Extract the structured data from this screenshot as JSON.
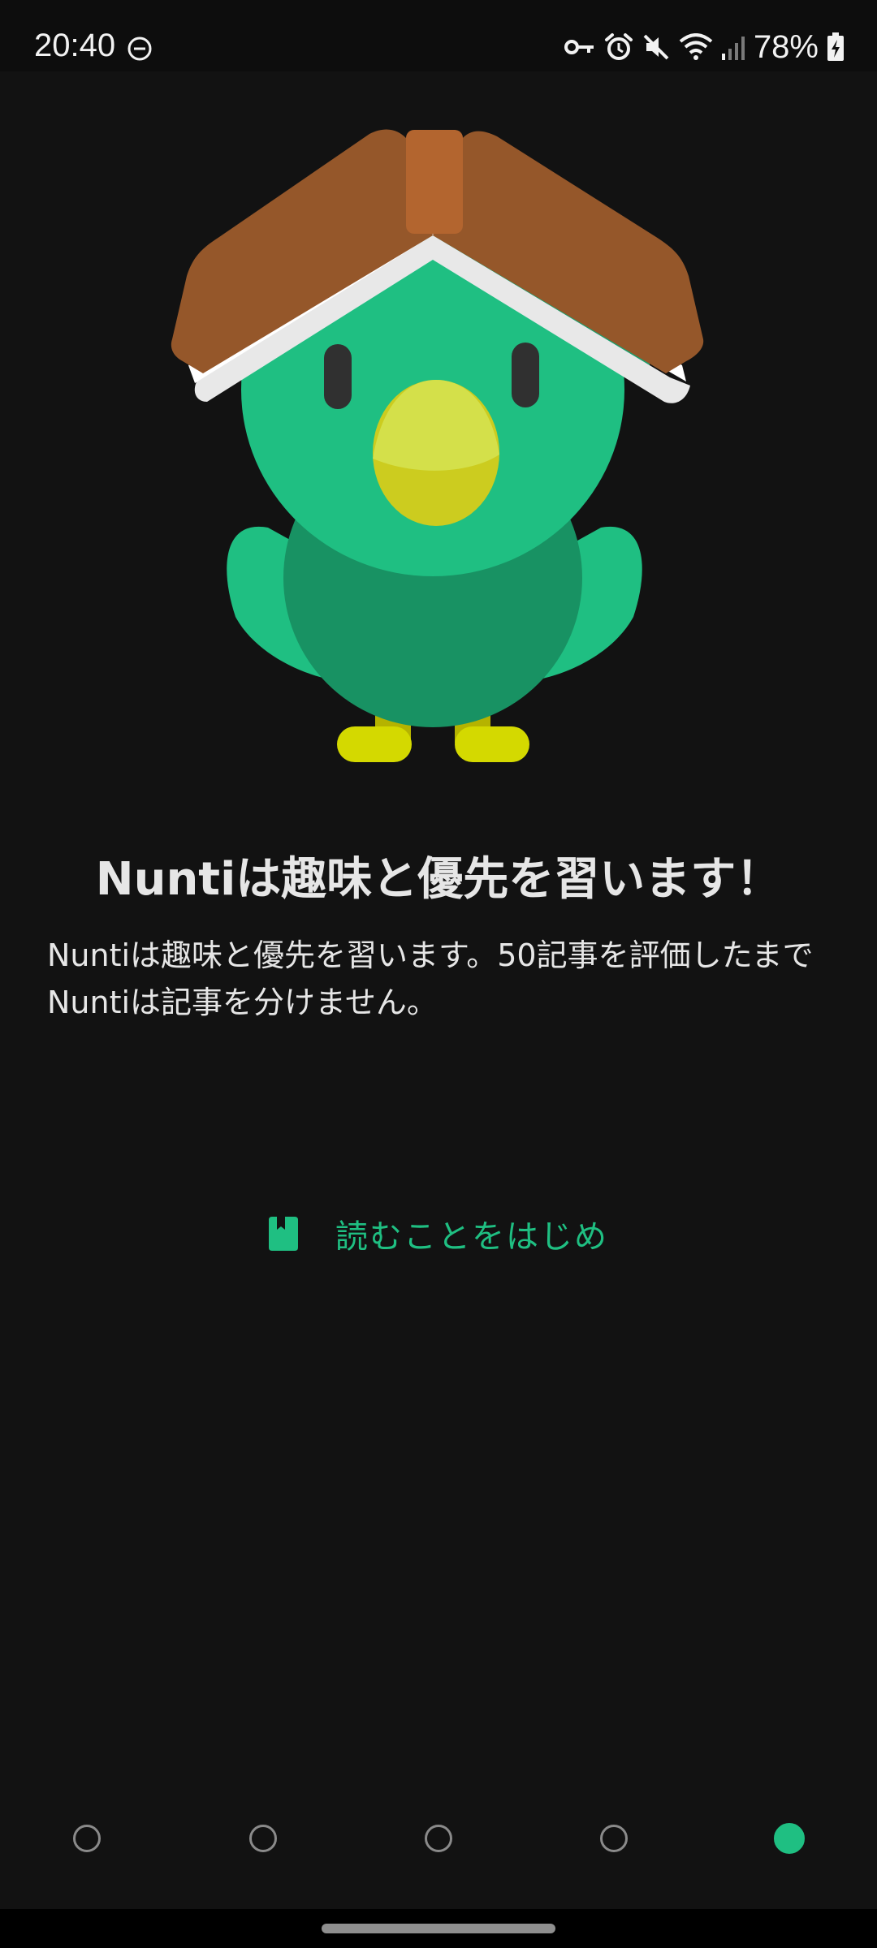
{
  "status_bar": {
    "time": "20:40",
    "battery_percent": "78%",
    "icons": [
      "do-not-disturb-icon",
      "vpn-key-icon",
      "alarm-icon",
      "mute-icon",
      "wifi-icon",
      "signal-icon",
      "battery-charging-icon"
    ]
  },
  "onboarding": {
    "headline": "Nuntiは趣味と優先を習います！",
    "body": "Nuntiは趣味と優先を習います。50記事を評価したまでNuntiは記事を分けません。",
    "start_button": {
      "label": "読むことをはじめ",
      "icon": "book-icon"
    }
  },
  "pager": {
    "total_pages": 5,
    "current_page": 5
  },
  "colors": {
    "background": "#121212",
    "accent": "#1fbf82",
    "text": "#e6e6e6"
  }
}
